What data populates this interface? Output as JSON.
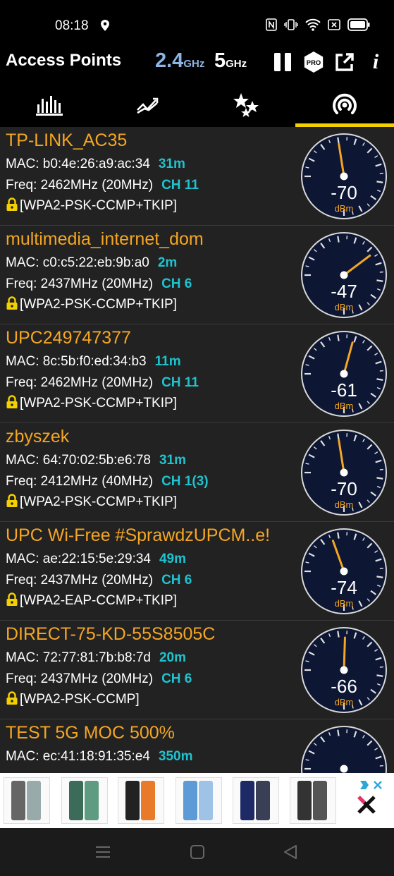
{
  "status": {
    "time": "08:18"
  },
  "app": {
    "title": "Access Points",
    "band_24": "2.4",
    "band_24_unit": "GHz",
    "band_5": "5",
    "band_5_unit": "GHz",
    "pro_badge": "PRO",
    "info_icon": "i"
  },
  "tabs": [
    {
      "icon": "bar-chart-icon",
      "active": false
    },
    {
      "icon": "graph-line-icon",
      "active": false
    },
    {
      "icon": "stars-icon",
      "active": false
    },
    {
      "icon": "access-point-icon",
      "active": true
    }
  ],
  "access_points": [
    {
      "ssid": "TP-LINK_AC35",
      "mac": "MAC: b0:4e:26:a9:ac:34",
      "distance": "31m",
      "freq": "Freq: 2462MHz",
      "width": "(20MHz)",
      "channel": "CH 11",
      "security": "[WPA2-PSK-CCMP+TKIP]",
      "dbm": -70,
      "dbm_text": "-70"
    },
    {
      "ssid": "multimedia_internet_dom",
      "mac": "MAC: c0:c5:22:eb:9b:a0",
      "distance": "2m",
      "freq": "Freq: 2437MHz",
      "width": "(20MHz)",
      "channel": "CH 6",
      "security": "[WPA2-PSK-CCMP+TKIP]",
      "dbm": -47,
      "dbm_text": "-47"
    },
    {
      "ssid": "UPC249747377",
      "mac": "MAC: 8c:5b:f0:ed:34:b3",
      "distance": "11m",
      "freq": "Freq: 2462MHz",
      "width": "(20MHz)",
      "channel": "CH 11",
      "security": "[WPA2-PSK-CCMP+TKIP]",
      "dbm": -61,
      "dbm_text": "-61"
    },
    {
      "ssid": "zbyszek",
      "mac": "MAC: 64:70:02:5b:e6:78",
      "distance": "31m",
      "freq": "Freq: 2412MHz",
      "width": "(40MHz)",
      "channel": "CH 1(3)",
      "security": "[WPA2-PSK-CCMP+TKIP]",
      "dbm": -70,
      "dbm_text": "-70"
    },
    {
      "ssid": "UPC Wi-Free #SprawdzUPCM..e!",
      "mac": "MAC: ae:22:15:5e:29:34",
      "distance": "49m",
      "freq": "Freq: 2437MHz",
      "width": "(20MHz)",
      "channel": "CH 6",
      "security": "[WPA2-EAP-CCMP+TKIP]",
      "dbm": -74,
      "dbm_text": "-74"
    },
    {
      "ssid": "DIRECT-75-KD-55S8505C",
      "mac": "MAC: 72:77:81:7b:b8:7d",
      "distance": "20m",
      "freq": "Freq: 2437MHz",
      "width": "(20MHz)",
      "channel": "CH 6",
      "security": "[WPA2-PSK-CCMP]",
      "dbm": -66,
      "dbm_text": "-66"
    },
    {
      "ssid": "TEST 5G MOC 500%",
      "mac": "MAC: ec:41:18:91:35:e4",
      "distance": "350m",
      "freq": "",
      "width": "",
      "channel": "",
      "security": "",
      "dbm": null,
      "dbm_text": ""
    }
  ],
  "gauge_unit": "dBm",
  "colors": {
    "ssid": "#f5a623",
    "accent": "#1fc3cf",
    "band_24": "#8db4e2",
    "tab_indicator": "#f5d000",
    "needle": "#f5a623",
    "gauge_face": "#0d1633"
  }
}
